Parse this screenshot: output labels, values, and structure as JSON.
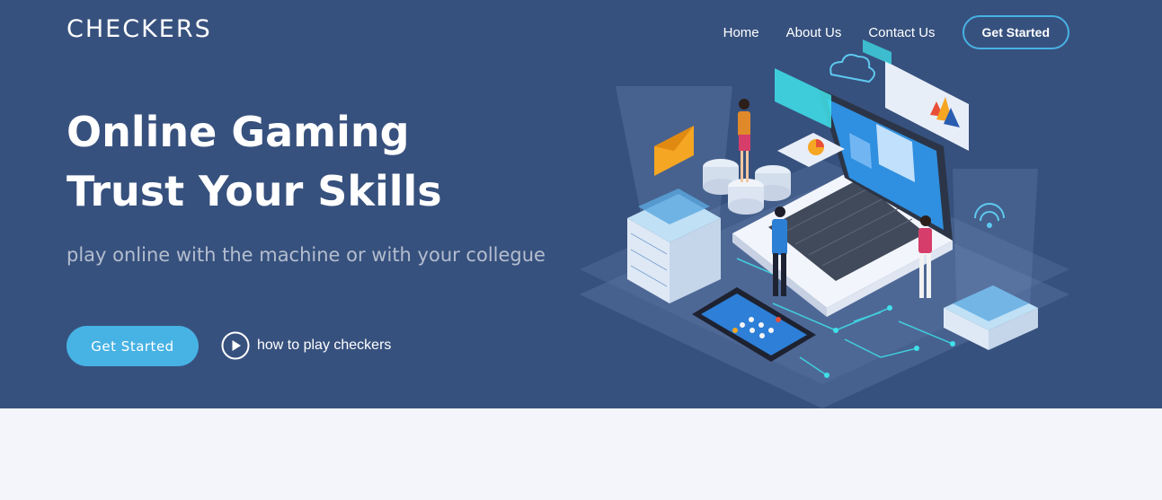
{
  "brand": {
    "logo": "CHECKERS"
  },
  "nav": {
    "items": [
      {
        "label": "Home"
      },
      {
        "label": "About Us"
      },
      {
        "label": "Contact Us"
      }
    ],
    "cta_label": "Get Started"
  },
  "hero": {
    "title_line1": "Online Gaming",
    "title_line2": "Trust Your Skills",
    "subtitle": "play online with the machine or with your collegue",
    "cta_label": "Get Started",
    "video_label": "how to play checkers",
    "play_icon": "play-circle-icon"
  },
  "colors": {
    "hero_bg": "#37517e",
    "accent": "#47b2e4",
    "page_bg": "#f3f5fa"
  },
  "illustration": {
    "name": "isometric-gaming-illustration"
  }
}
